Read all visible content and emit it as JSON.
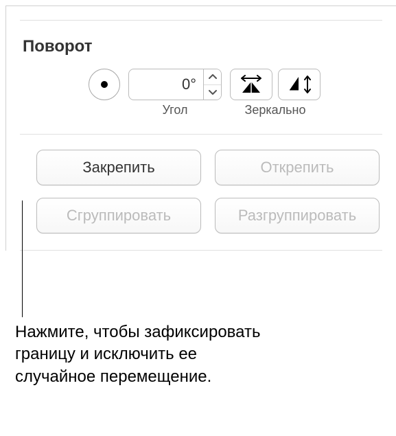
{
  "section": {
    "title": "Поворот"
  },
  "rotation": {
    "angle_value": "0°",
    "angle_label": "Угол",
    "flip_label": "Зеркально"
  },
  "buttons": {
    "lock": "Закрепить",
    "unlock": "Открепить",
    "group": "Сгруппировать",
    "ungroup": "Разгруппировать"
  },
  "callout": {
    "text": "Нажмите, чтобы зафиксировать границу и исключить ее случайное перемещение."
  }
}
